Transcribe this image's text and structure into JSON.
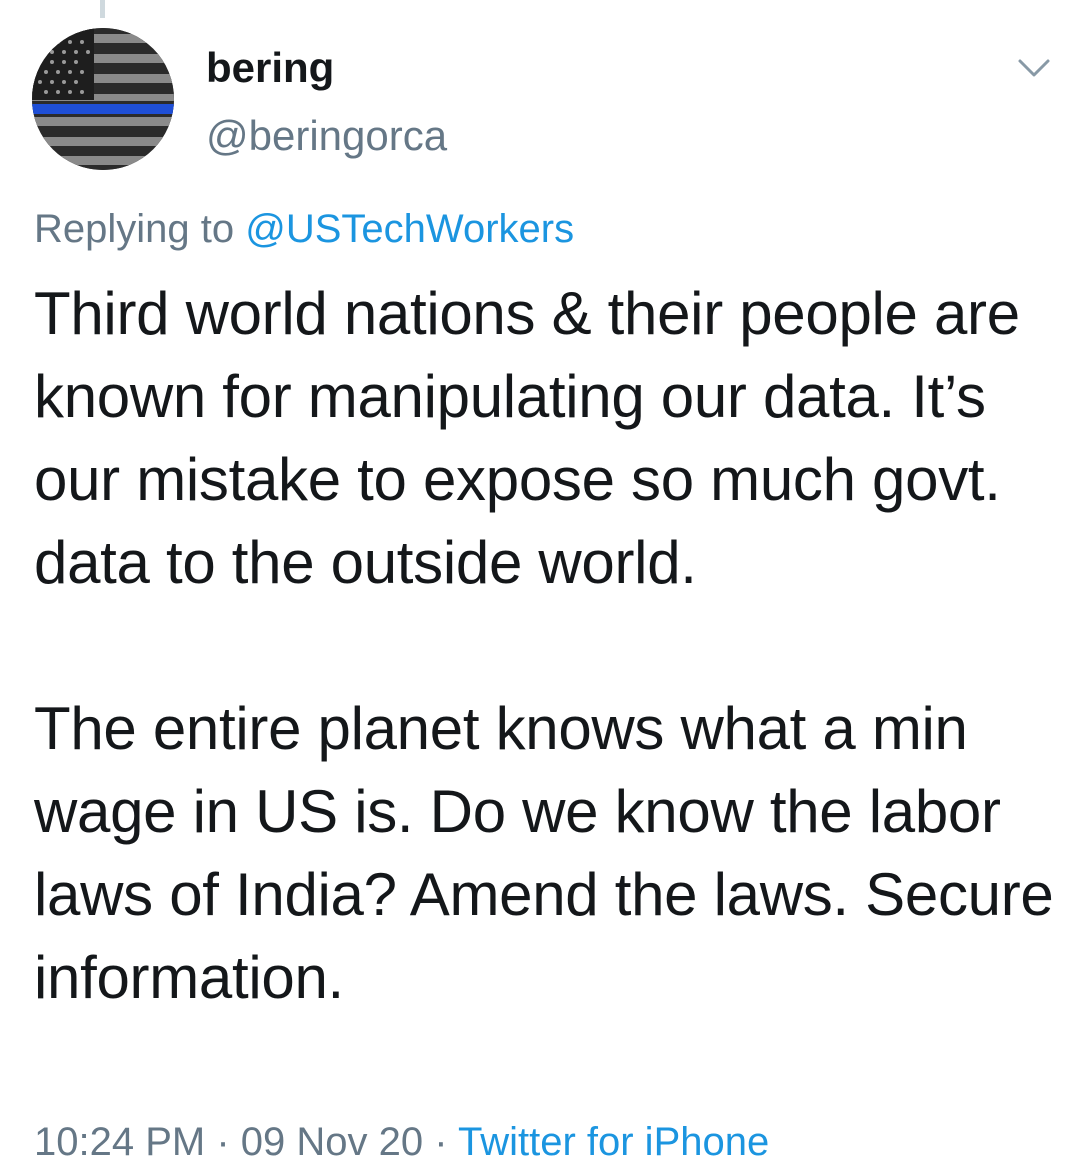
{
  "author": {
    "display_name": "bering",
    "handle": "@beringorca",
    "avatar_icon": "thin-blue-line-flag-icon"
  },
  "reply": {
    "prefix": "Replying to",
    "mention": "@USTechWorkers"
  },
  "tweet": {
    "text": "Third world nations & their people are known for manipulating our data. It’s our mistake to expose so much govt. data to the outside world.\n\nThe entire planet knows what a min wage in US is. Do we know the labor laws of India? Amend the laws. Secure information."
  },
  "meta": {
    "time": "10:24 PM",
    "separator1": "·",
    "date": "09 Nov 20",
    "separator2": "·",
    "source": "Twitter for iPhone"
  },
  "colors": {
    "text": "#14171a",
    "secondary": "#657786",
    "link": "#1b95e0",
    "flag_blue_line": "#1f4fd6"
  },
  "icons": {
    "menu": "chevron-down-icon"
  }
}
